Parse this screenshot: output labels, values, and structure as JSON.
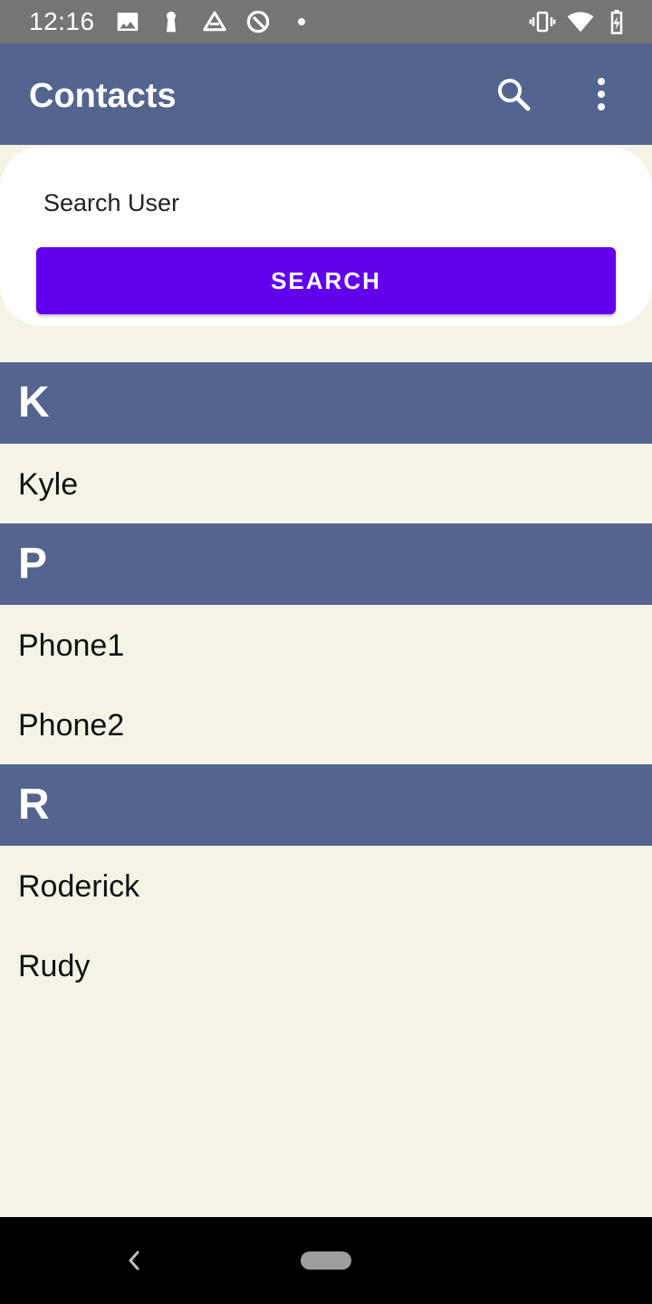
{
  "status_bar": {
    "time": "12:16",
    "left_icons": [
      "image-icon",
      "keyhole-icon",
      "drive-icon",
      "data-saver-icon",
      "dot-icon"
    ],
    "right_icons": [
      "vibrate-icon",
      "wifi-icon",
      "battery-charging-icon"
    ]
  },
  "app_bar": {
    "title": "Contacts",
    "actions": [
      "search-icon",
      "overflow-menu-icon"
    ],
    "color": "#53658F"
  },
  "search": {
    "placeholder": "Search User",
    "button_label": "SEARCH",
    "button_color": "#6200EE"
  },
  "contacts": {
    "sections": [
      {
        "letter": "K",
        "items": [
          "Kyle"
        ]
      },
      {
        "letter": "P",
        "items": [
          "Phone1",
          "Phone2"
        ]
      },
      {
        "letter": "R",
        "items": [
          "Roderick",
          "Rudy"
        ]
      }
    ]
  },
  "nav_bar": {
    "buttons": [
      "back-icon",
      "home-pill"
    ]
  }
}
